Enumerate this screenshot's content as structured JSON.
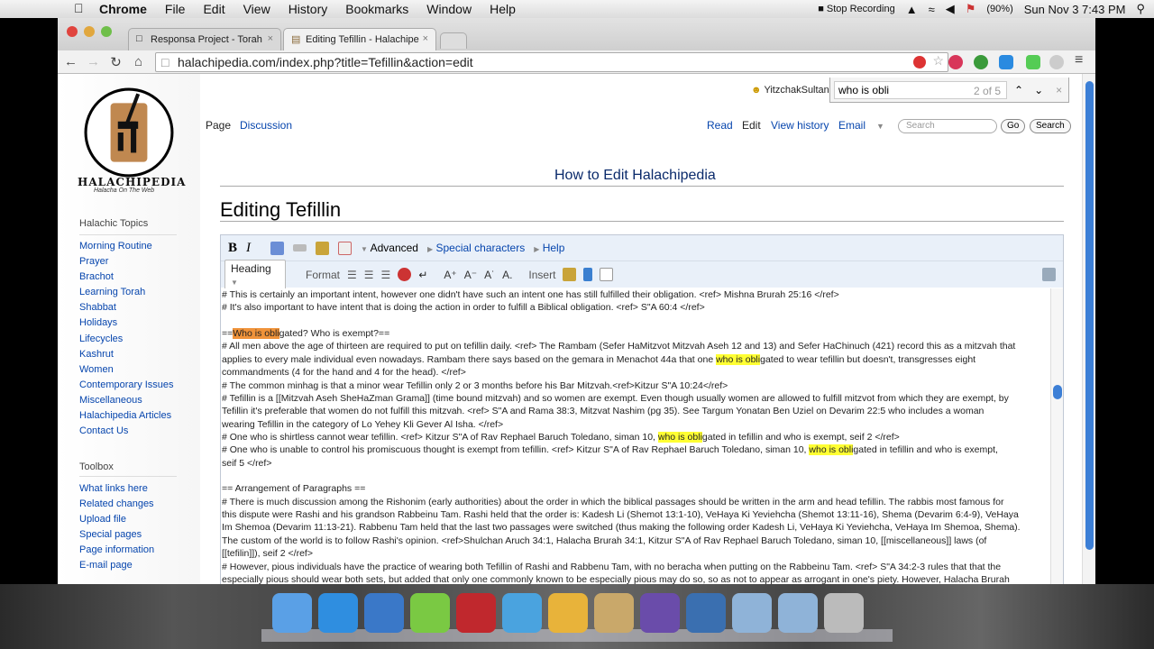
{
  "menubar": {
    "app": "Chrome",
    "items": [
      "File",
      "Edit",
      "View",
      "History",
      "Bookmarks",
      "Window",
      "Help"
    ],
    "stop_recording": "Stop Recording",
    "battery": "(90%)",
    "datetime": "Sun Nov 3  7:43 PM"
  },
  "tabs": [
    {
      "label": "Responsa Project - Torah"
    },
    {
      "label": "Editing Tefillin - Halachipe"
    }
  ],
  "url": "halachipedia.com/index.php?title=Tefillin&action=edit",
  "find": {
    "query": "who is obli",
    "count": "2 of 5"
  },
  "user": "YitzchakSultan",
  "logo": {
    "name": "HALACHIPEDIA",
    "tagline": "Halacha On The Web"
  },
  "sidebar": {
    "topics_heading": "Halachic Topics",
    "topics": [
      "Morning Routine",
      "Prayer",
      "Brachot",
      "Learning Torah",
      "Shabbat",
      "Holidays",
      "Lifecycles",
      "Kashrut",
      "Women",
      "Contemporary Issues",
      "Miscellaneous",
      "Halachipedia Articles",
      "Contact Us"
    ],
    "toolbox_heading": "Toolbox",
    "toolbox": [
      "What links here",
      "Related changes",
      "Upload file",
      "Special pages",
      "Page information",
      "E-mail page"
    ]
  },
  "content_tabs": {
    "page": "Page",
    "discussion": "Discussion",
    "read": "Read",
    "edit": "Edit",
    "history": "View history",
    "email": "Email"
  },
  "search": {
    "placeholder": "Search",
    "go": "Go",
    "search": "Search"
  },
  "banner": "How to Edit Halachipedia",
  "title": "Editing Tefillin",
  "editor_toolbar": {
    "advanced": "Advanced",
    "special": "Special characters",
    "help": "Help",
    "heading": "Heading",
    "format": "Format",
    "insert": "Insert"
  },
  "editor_lines": [
    {
      "pre": "# This is certainly an important intent, however one didn't have such an intent one has still fulfilled their obligation. <ref> Mishna Brurah 25:16 </ref>"
    },
    {
      "pre": "# It's also important to have intent that is doing the action in order to fulfill a Biblical obligation. <ref> S\"A 60:4 </ref>"
    },
    {
      "pre": ""
    },
    {
      "pre": "==",
      "hit": "Who is obli",
      "current": true,
      "post": "gated? Who is exempt?=="
    },
    {
      "pre": "# All men above the age of thirteen are required to put on tefillin daily. <ref> The Rambam (Sefer HaMitzvot Mitzvah Aseh 12 and 13) and Sefer HaChinuch (421) record this as a mitzvah that"
    },
    {
      "pre": "applies to every male individual even nowadays. Rambam there says based on the gemara in Menachot 44a that one ",
      "hit": "who is obli",
      "post": "gated to wear tefillin but doesn't, transgresses eight"
    },
    {
      "pre": "commandments (4 for the hand and 4 for the head). </ref>"
    },
    {
      "pre": "# The common minhag is that a minor wear Tefillin only 2 or 3 months before his Bar Mitzvah.<ref>Kitzur S\"A 10:24</ref>"
    },
    {
      "pre": "# Tefillin is a [[Mitzvah Aseh SheHaZman Grama]] (time bound mitzvah) and so women are exempt. Even though usually women are allowed to fulfill mitzvot from which they are exempt, by"
    },
    {
      "pre": "Tefillin it's preferable that women do not fulfill this mitzvah. <ref> S\"A and Rama 38:3, Mitzvat Nashim (pg 35). See Targum Yonatan Ben Uziel on Devarim 22:5 who includes a woman"
    },
    {
      "pre": "wearing Tefillin in the category of Lo Yehey Kli Gever Al Isha. </ref>"
    },
    {
      "pre": "# One who is shirtless cannot wear tefillin. <ref> Kitzur S\"A of Rav Rephael Baruch Toledano, siman 10, ",
      "hit": "who is obli",
      "post": "gated in tefillin and who is exempt, seif 2 </ref>"
    },
    {
      "pre": "# One who is unable to control his promiscuous thought is exempt from tefillin. <ref> Kitzur S\"A of Rav Rephael Baruch Toledano, siman 10, ",
      "hit": "who is obli",
      "post": "gated in tefillin and who is exempt,"
    },
    {
      "pre": "seif 5 </ref>"
    },
    {
      "pre": ""
    },
    {
      "pre": "== Arrangement of Paragraphs =="
    },
    {
      "pre": "# There is much discussion among the Rishonim (early authorities) about the order in which the biblical passages should be written in the arm and head tefillin. The rabbis most famous for"
    },
    {
      "pre": "this dispute were Rashi and his grandson Rabbeinu Tam. Rashi held that the order is: Kadesh Li (Shemot 13:1-10), VeHaya Ki Yeviehcha (Shemot 13:11-16), Shema (Devarim 6:4-9), VeHaya"
    },
    {
      "pre": "Im Shemoa (Devarim 11:13-21). Rabbenu Tam held that the last two passages were switched (thus making the following order Kadesh Li, VeHaya Ki Yeviehcha, VeHaya Im Shemoa, Shema)."
    },
    {
      "pre": "The custom of the world is to follow Rashi's opinion. <ref>Shulchan Aruch 34:1, Halacha Brurah 34:1, Kitzur S\"A of Rav Rephael Baruch Toledano, siman 10, [[miscellaneous]] laws (of"
    },
    {
      "pre": "[[tefilin]]), seif 2 </ref>"
    },
    {
      "pre": "# However, pious individuals have the practice of wearing both Tefillin of Rashi and Rabbenu Tam, with no beracha when putting on the Rabbeinu Tam. <ref> S\"A 34:2-3 rules that that the"
    },
    {
      "pre": "especially pious should wear both sets, but added that only one commonly known to be especially pious may do so, so as not to appear as arrogant in one's piety. However, Halacha Brurah"
    }
  ],
  "colors": {
    "link": "#0645ad",
    "find_highlight": "#ffff33",
    "current_match": "#f0933a"
  },
  "dock": [
    {
      "icon": "finder-icon",
      "color": "#5aa0e6"
    },
    {
      "icon": "itunes-icon",
      "color": "#2f8ee0"
    },
    {
      "icon": "word-icon",
      "color": "#3a78c8"
    },
    {
      "icon": "phone-icon",
      "color": "#7ac943"
    },
    {
      "icon": "filezilla-icon",
      "color": "#c0282d"
    },
    {
      "icon": "bird-icon",
      "color": "#4aa3df"
    },
    {
      "icon": "chrome-icon",
      "color": "#e8b33a"
    },
    {
      "icon": "book-icon",
      "color": "#c9a86a"
    },
    {
      "icon": "eclipse-icon",
      "color": "#6a4caa"
    },
    {
      "icon": "browser-icon",
      "color": "#3a6fb0"
    },
    {
      "icon": "applications-folder-icon",
      "color": "#8fb3d8"
    },
    {
      "icon": "documents-folder-icon",
      "color": "#8fb3d8"
    },
    {
      "icon": "trash-icon",
      "color": "#bbbbbb"
    }
  ]
}
